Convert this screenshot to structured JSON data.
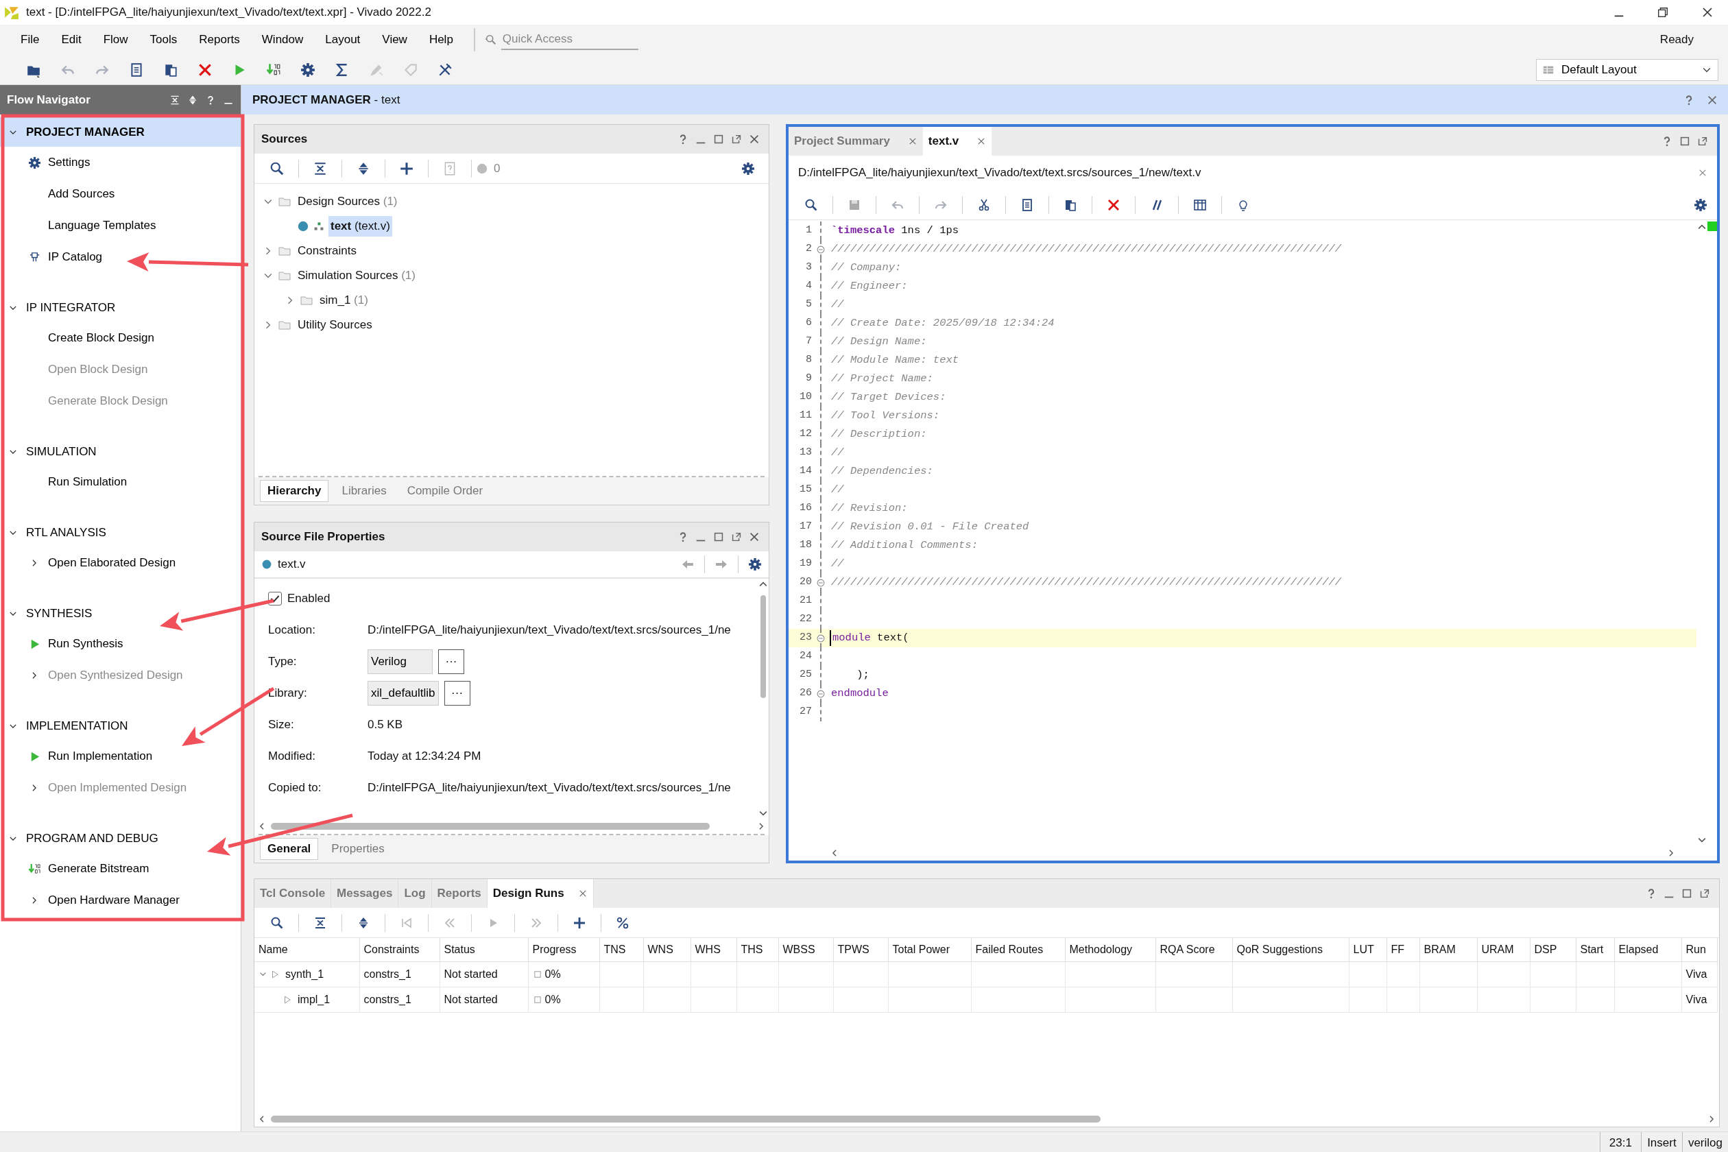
{
  "window": {
    "title": "text - [D:/intelFPGA_lite/haiyunjiexun/text_Vivado/text/text.xpr] - Vivado 2022.2"
  },
  "menu": [
    "File",
    "Edit",
    "Flow",
    "Tools",
    "Reports",
    "Window",
    "Layout",
    "View",
    "Help"
  ],
  "quick_access": {
    "placeholder": "Quick Access"
  },
  "status": "Ready",
  "layout_select": {
    "value": "Default Layout"
  },
  "flow_navigator": {
    "title": "Flow Navigator",
    "sections": [
      {
        "label": "PROJECT MANAGER",
        "selected": true,
        "expanded": true,
        "items": [
          {
            "label": "Settings",
            "kind": "settings",
            "disabled": false
          },
          {
            "label": "Add Sources",
            "kind": "plain",
            "disabled": false
          },
          {
            "label": "Language Templates",
            "kind": "plain",
            "disabled": false
          },
          {
            "label": "IP Catalog",
            "kind": "ip",
            "disabled": false
          }
        ]
      },
      {
        "label": "IP INTEGRATOR",
        "selected": false,
        "expanded": true,
        "items": [
          {
            "label": "Create Block Design",
            "kind": "plain",
            "disabled": false
          },
          {
            "label": "Open Block Design",
            "kind": "plain",
            "disabled": true
          },
          {
            "label": "Generate Block Design",
            "kind": "plain",
            "disabled": true
          }
        ]
      },
      {
        "label": "SIMULATION",
        "selected": false,
        "expanded": true,
        "items": [
          {
            "label": "Run Simulation",
            "kind": "plain",
            "disabled": false
          }
        ]
      },
      {
        "label": "RTL ANALYSIS",
        "selected": false,
        "expanded": true,
        "items": [
          {
            "label": "Open Elaborated Design",
            "kind": "expandable",
            "disabled": false
          }
        ]
      },
      {
        "label": "SYNTHESIS",
        "selected": false,
        "expanded": true,
        "items": [
          {
            "label": "Run Synthesis",
            "kind": "run",
            "disabled": false
          },
          {
            "label": "Open Synthesized Design",
            "kind": "expandable",
            "disabled": true
          }
        ]
      },
      {
        "label": "IMPLEMENTATION",
        "selected": false,
        "expanded": true,
        "items": [
          {
            "label": "Run Implementation",
            "kind": "run",
            "disabled": false
          },
          {
            "label": "Open Implemented Design",
            "kind": "expandable",
            "disabled": true
          }
        ]
      },
      {
        "label": "PROGRAM AND DEBUG",
        "selected": false,
        "expanded": true,
        "items": [
          {
            "label": "Generate Bitstream",
            "kind": "bitstream",
            "disabled": false
          },
          {
            "label": "Open Hardware Manager",
            "kind": "expandable",
            "disabled": false
          }
        ]
      }
    ]
  },
  "main_header": {
    "title": "**PROJECT MANAGER** - text"
  },
  "sources": {
    "title": "Sources",
    "count": "0",
    "tree": [
      {
        "label": "Design Sources",
        "count": "(1)",
        "kind": "folder",
        "expanded": true,
        "selected": false,
        "children": [
          {
            "label": "text",
            "detail": "(text.v)",
            "kind": "module",
            "selected": true
          }
        ]
      },
      {
        "label": "Constraints",
        "kind": "folder",
        "expanded": false,
        "selected": false
      },
      {
        "label": "Simulation Sources",
        "count": "(1)",
        "kind": "folder",
        "expanded": true,
        "selected": false,
        "children": [
          {
            "label": "sim_1",
            "count": "(1)",
            "kind": "folder",
            "expanded": false,
            "selected": false
          }
        ]
      },
      {
        "label": "Utility Sources",
        "kind": "folder",
        "expanded": false,
        "selected": false
      }
    ],
    "tabs": [
      {
        "label": "Hierarchy",
        "selected": true
      },
      {
        "label": "Libraries",
        "selected": false
      },
      {
        "label": "Compile Order",
        "selected": false
      }
    ]
  },
  "source_file_properties": {
    "title": "Source File Properties",
    "file": "text.v",
    "enabled": {
      "label": "Enabled",
      "checked": true
    },
    "fields": [
      {
        "label": "Location:",
        "value": "D:/intelFPGA_lite/haiyunjiexun/text_Vivado/text/text.srcs/sources_1/ne",
        "kind": "text"
      },
      {
        "label": "Type:",
        "value": "Verilog",
        "kind": "choice",
        "button": "···"
      },
      {
        "label": "Library:",
        "value": "xil_defaultlib",
        "kind": "choice",
        "button": "···"
      },
      {
        "label": "Size:",
        "value": "0.5 KB",
        "kind": "text"
      },
      {
        "label": "Modified:",
        "value": "Today at 12:34:24 PM",
        "kind": "text"
      },
      {
        "label": "Copied to:",
        "value": "D:/intelFPGA_lite/haiyunjiexun/text_Vivado/text/text.srcs/sources_1/ne",
        "kind": "text"
      }
    ],
    "tabs": [
      {
        "label": "General",
        "selected": true
      },
      {
        "label": "Properties",
        "selected": false
      }
    ]
  },
  "editor": {
    "tabs": [
      {
        "label": "Project Summary",
        "selected": false
      },
      {
        "label": "text.v",
        "selected": true
      }
    ],
    "path": "D:/intelFPGA_lite/haiyunjiexun/text_Vivado/text/text.srcs/sources_1/new/text.v",
    "lines": [
      {
        "number": "1",
        "keyword": "`timescale",
        "text": " 1ns / 1ps",
        "kind": "code",
        "fold": false,
        "highlighted": false
      },
      {
        "number": "2",
        "text": "////////////////////////////////////////////////////////////////////////////////",
        "kind": "comment",
        "fold": true,
        "highlighted": false
      },
      {
        "number": "3",
        "text": "// Company:",
        "kind": "comment",
        "fold": false,
        "highlighted": false
      },
      {
        "number": "4",
        "text": "// Engineer:",
        "kind": "comment",
        "fold": false,
        "highlighted": false
      },
      {
        "number": "5",
        "text": "//",
        "kind": "comment",
        "fold": false,
        "highlighted": false
      },
      {
        "number": "6",
        "text": "// Create Date: 2025/09/18 12:34:24",
        "kind": "comment",
        "fold": false,
        "highlighted": false
      },
      {
        "number": "7",
        "text": "// Design Name:",
        "kind": "comment",
        "fold": false,
        "highlighted": false
      },
      {
        "number": "8",
        "text": "// Module Name: text",
        "kind": "comment",
        "fold": false,
        "highlighted": false
      },
      {
        "number": "9",
        "text": "// Project Name:",
        "kind": "comment",
        "fold": false,
        "highlighted": false
      },
      {
        "number": "10",
        "text": "// Target Devices:",
        "kind": "comment",
        "fold": false,
        "highlighted": false
      },
      {
        "number": "11",
        "text": "// Tool Versions:",
        "kind": "comment",
        "fold": false,
        "highlighted": false
      },
      {
        "number": "12",
        "text": "// Description:",
        "kind": "comment",
        "fold": false,
        "highlighted": false
      },
      {
        "number": "13",
        "text": "//",
        "kind": "comment",
        "fold": false,
        "highlighted": false
      },
      {
        "number": "14",
        "text": "// Dependencies:",
        "kind": "comment",
        "fold": false,
        "highlighted": false
      },
      {
        "number": "15",
        "text": "//",
        "kind": "comment",
        "fold": false,
        "highlighted": false
      },
      {
        "number": "16",
        "text": "// Revision:",
        "kind": "comment",
        "fold": false,
        "highlighted": false
      },
      {
        "number": "17",
        "text": "// Revision 0.01 - File Created",
        "kind": "comment",
        "fold": false,
        "highlighted": false
      },
      {
        "number": "18",
        "text": "// Additional Comments:",
        "kind": "comment",
        "fold": false,
        "highlighted": false
      },
      {
        "number": "19",
        "text": "//",
        "kind": "comment",
        "fold": false,
        "highlighted": false
      },
      {
        "number": "20",
        "text": "////////////////////////////////////////////////////////////////////////////////",
        "kind": "comment",
        "fold": true,
        "highlighted": false
      },
      {
        "number": "21",
        "kind": "blank",
        "fold": false,
        "highlighted": false
      },
      {
        "number": "22",
        "kind": "blank",
        "fold": false,
        "highlighted": false
      },
      {
        "number": "23",
        "keyword": "module",
        "text": " text(",
        "kind": "code",
        "fold": true,
        "highlighted": true
      },
      {
        "number": "24",
        "kind": "blank",
        "fold": false,
        "highlighted": false
      },
      {
        "number": "25",
        "text": "    );",
        "kind": "code",
        "fold": false,
        "highlighted": false
      },
      {
        "number": "26",
        "keyword": "endmodule",
        "kind": "code",
        "fold": true,
        "highlighted": false
      },
      {
        "number": "27",
        "kind": "blank",
        "fold": false,
        "highlighted": false
      }
    ]
  },
  "bottom_panel": {
    "tabs": [
      {
        "label": "Tcl Console",
        "selected": false
      },
      {
        "label": "Messages",
        "selected": false
      },
      {
        "label": "Log",
        "selected": false
      },
      {
        "label": "Reports",
        "selected": false
      },
      {
        "label": "Design Runs",
        "selected": true
      }
    ],
    "table": {
      "columns": [
        "Name",
        "Constraints",
        "Status",
        "Progress",
        "TNS",
        "WNS",
        "WHS",
        "THS",
        "WBSS",
        "TPWS",
        "Total Power",
        "Failed Routes",
        "Methodology",
        "RQA Score",
        "QoR Suggestions",
        "LUT",
        "FF",
        "BRAM",
        "URAM",
        "DSP",
        "Start",
        "Elapsed",
        "Run"
      ],
      "rows": [
        {
          "name": "synth_1",
          "constraints": "constrs_1",
          "status": "Not started",
          "progress": "0%",
          "run": "Viva",
          "expanded": true,
          "children": [
            {
              "name": "impl_1",
              "constraints": "constrs_1",
              "status": "Not started",
              "progress": "0%",
              "run": "Viva"
            }
          ]
        }
      ]
    }
  },
  "status_bar": [
    "23:1",
    "Insert",
    "verilog"
  ]
}
